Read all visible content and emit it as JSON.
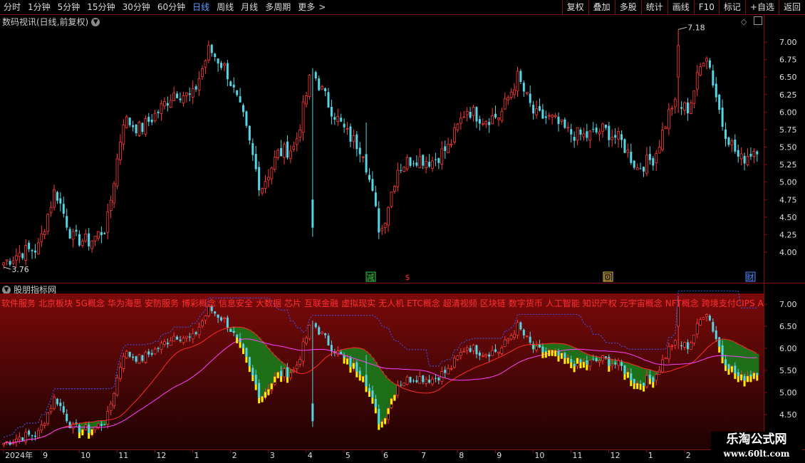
{
  "toolbar": {
    "periods": [
      "分时",
      "1分钟",
      "5分钟",
      "15分钟",
      "30分钟",
      "60分钟",
      "日线",
      "周线",
      "月线",
      "多周期",
      "更多"
    ],
    "active_period": "日线",
    "right_buttons": [
      "复权",
      "叠加",
      "多股",
      "统计",
      "画线",
      "F10",
      "标记",
      "+自选",
      "返回"
    ]
  },
  "main_panel": {
    "title": "数码视讯(日线,前复权)",
    "y_ticks": [
      "7.00",
      "6.75",
      "6.50",
      "6.25",
      "6.00",
      "5.75",
      "5.50",
      "5.25",
      "5.00",
      "4.75",
      "4.50",
      "4.25",
      "4.00"
    ],
    "high_label": "7.18",
    "low_label": "3.76",
    "markers": [
      {
        "text": "减",
        "color": "#2ecc40"
      },
      {
        "text": "$",
        "color": "#ff3030"
      },
      {
        "text": "回",
        "color": "#f5c542"
      },
      {
        "text": "财",
        "color": "#4a7fff"
      }
    ]
  },
  "indicator_panel": {
    "title": "股朋指标网",
    "concepts": [
      "软件服务",
      "北京板块",
      "5G概念",
      "华为海思",
      "安防服务",
      "博彩概念",
      "信息安全",
      "大数据",
      "芯片",
      "互联金融",
      "虚拟现实",
      "无人机",
      "ETC概念",
      "超清视频",
      "区块链",
      "数字货币",
      "人工智能",
      "知识产权",
      "元宇宙概念",
      "NFT概念",
      "跨境支付CIPS",
      "AIGC"
    ],
    "y_ticks": [
      "7.00",
      "6.50",
      "6.00",
      "5.50",
      "5.00",
      "4.50"
    ]
  },
  "x_axis": {
    "labels": [
      "2024年",
      "9",
      "10",
      "11",
      "12",
      "1",
      "2",
      "3",
      "4",
      "5",
      "6",
      "7",
      "8",
      "9",
      "10",
      "11",
      "12",
      "1",
      "2",
      "3"
    ]
  },
  "watermark": {
    "line1": "乐淘公式网",
    "line2": "www.60lt.com"
  },
  "colors": {
    "up": "#ff3a3a",
    "down": "#55d6e6",
    "border": "#7a1212",
    "accent": "#5aa0ff"
  },
  "chart_data": {
    "type": "candlestick",
    "title": "数码视讯(日线,前复权)",
    "ylim": [
      3.76,
      7.18
    ],
    "x_labels": [
      "2024年",
      "9",
      "10",
      "11",
      "12",
      "1",
      "2",
      "3",
      "4",
      "5",
      "6",
      "7",
      "8",
      "9",
      "10",
      "11",
      "12",
      "1",
      "2",
      "3"
    ],
    "anchors_close": [
      3.85,
      4.0,
      4.05,
      4.9,
      4.2,
      4.15,
      4.35,
      5.9,
      5.75,
      6.0,
      6.3,
      6.2,
      6.9,
      6.6,
      5.9,
      4.9,
      5.4,
      5.5,
      6.6,
      6.1,
      5.7,
      5.45,
      4.25,
      5.2,
      5.35,
      5.3,
      5.5,
      6.05,
      5.9,
      5.95,
      6.5,
      5.95,
      5.9,
      5.7,
      5.65,
      5.75,
      5.6,
      5.2,
      5.35,
      6.1,
      6.05,
      6.9,
      5.8,
      5.3,
      5.5
    ],
    "high": 7.18,
    "low": 3.76
  }
}
